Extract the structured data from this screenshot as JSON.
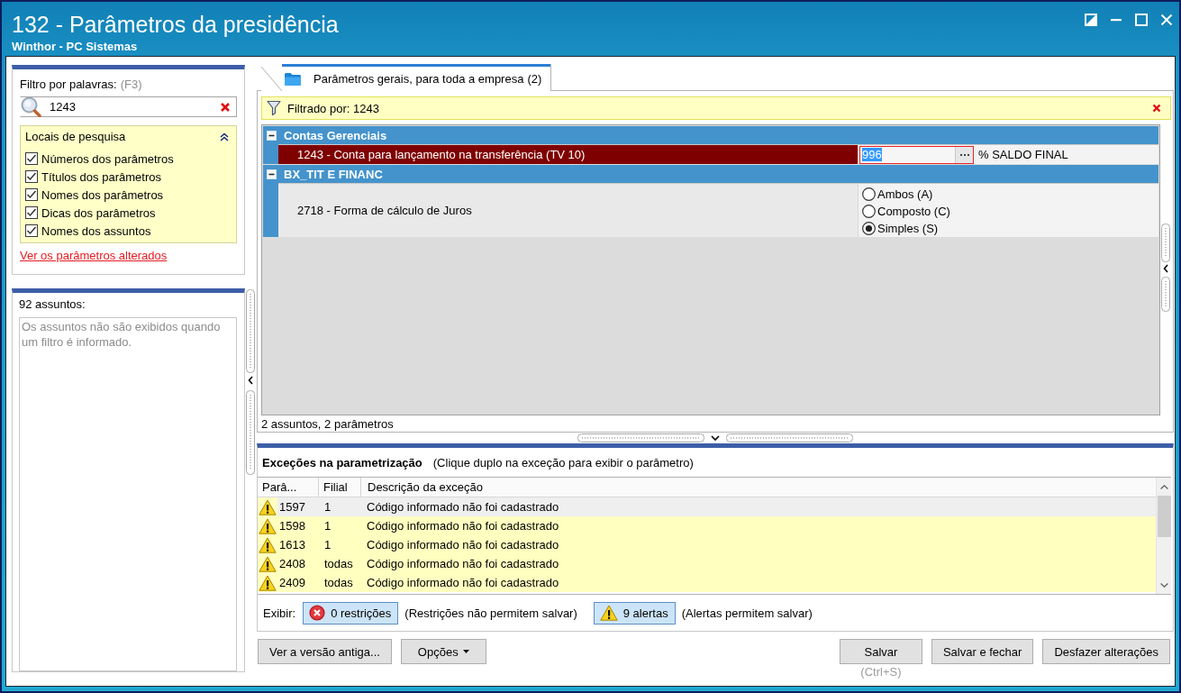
{
  "window": {
    "title": "132 - Parâmetros da presidência",
    "subtitle": "Winthor - PC Sistemas"
  },
  "filter_panel": {
    "label": "Filtro por palavras:",
    "shortcut": "(F3)",
    "search": {
      "value": "1243"
    },
    "search_locations": {
      "title": "Locais de pesquisa",
      "expanded": true,
      "options": [
        {
          "label": "Números dos parâmetros",
          "checked": true
        },
        {
          "label": "Títulos dos parâmetros",
          "checked": true
        },
        {
          "label": "Nomes dos parâmetros",
          "checked": true
        },
        {
          "label": "Dicas dos parâmetros",
          "checked": true
        },
        {
          "label": "Nomes dos assuntos",
          "checked": true
        }
      ]
    },
    "link": "Ver os parâmetros alterados"
  },
  "subjects_panel": {
    "count_label": "92 assuntos:",
    "message": "Os assuntos não são exibidos quando um filtro é informado."
  },
  "tabs": [
    {
      "label": "Parâmetros gerais, para toda a empresa",
      "count": "(2)",
      "selected": true
    }
  ],
  "filter_bar": {
    "text": "Filtrado por: 1243"
  },
  "groups": [
    {
      "title": "Contas Gerenciais",
      "expanded": true,
      "parameters": [
        {
          "kind": "lookup",
          "name": "1243 - Conta para lançamento na transferência (TV 10)",
          "selected": true,
          "value": "996",
          "focused": true,
          "description": "% SALDO FINAL"
        }
      ]
    },
    {
      "title": "BX_TIT E FINANC",
      "expanded": true,
      "parameters": [
        {
          "kind": "radio",
          "name": "2718 - Forma de cálculo de Juros",
          "selected": false,
          "options": [
            {
              "label": "Ambos (A)",
              "selected": false
            },
            {
              "label": "Composto (C)",
              "selected": false
            },
            {
              "label": "Simples (S)",
              "selected": true
            }
          ]
        }
      ]
    }
  ],
  "summary": "2 assuntos, 2 parâmetros",
  "exceptions": {
    "title": "Exceções na parametrização",
    "hint": "(Clique duplo na exceção para exibir o parâmetro)",
    "columns": [
      "Parâ...",
      "Filial",
      "Descrição da exceção"
    ],
    "rows": [
      {
        "parameter": "1597",
        "branch": "1",
        "description": "Código informado não foi cadastrado",
        "selected": true
      },
      {
        "parameter": "1598",
        "branch": "1",
        "description": "Código informado não foi cadastrado",
        "selected": false
      },
      {
        "parameter": "1613",
        "branch": "1",
        "description": "Código informado não foi cadastrado",
        "selected": false
      },
      {
        "parameter": "2408",
        "branch": "todas",
        "description": "Código informado não foi cadastrado",
        "selected": false
      },
      {
        "parameter": "2409",
        "branch": "todas",
        "description": "Código informado não foi cadastrado",
        "selected": false
      }
    ],
    "show_label": "Exibir:",
    "toggles": [
      {
        "kind": "restriction",
        "label": "0 restrições",
        "pressed": true,
        "note": "(Restrições não permitem salvar)"
      },
      {
        "kind": "alert",
        "label": "9 alertas",
        "pressed": true,
        "note": "(Alertas permitem salvar)"
      }
    ]
  },
  "footer": {
    "left": [
      {
        "kind": "plain",
        "label": "Ver a versão antiga..."
      },
      {
        "kind": "menu",
        "label": "Opções"
      }
    ],
    "right": [
      {
        "kind": "plain",
        "label": "Salvar",
        "shortcut": "(Ctrl+S)"
      },
      {
        "kind": "plain",
        "label": "Salvar e fechar"
      },
      {
        "kind": "plain",
        "label": "Desfazer alterações"
      }
    ]
  }
}
